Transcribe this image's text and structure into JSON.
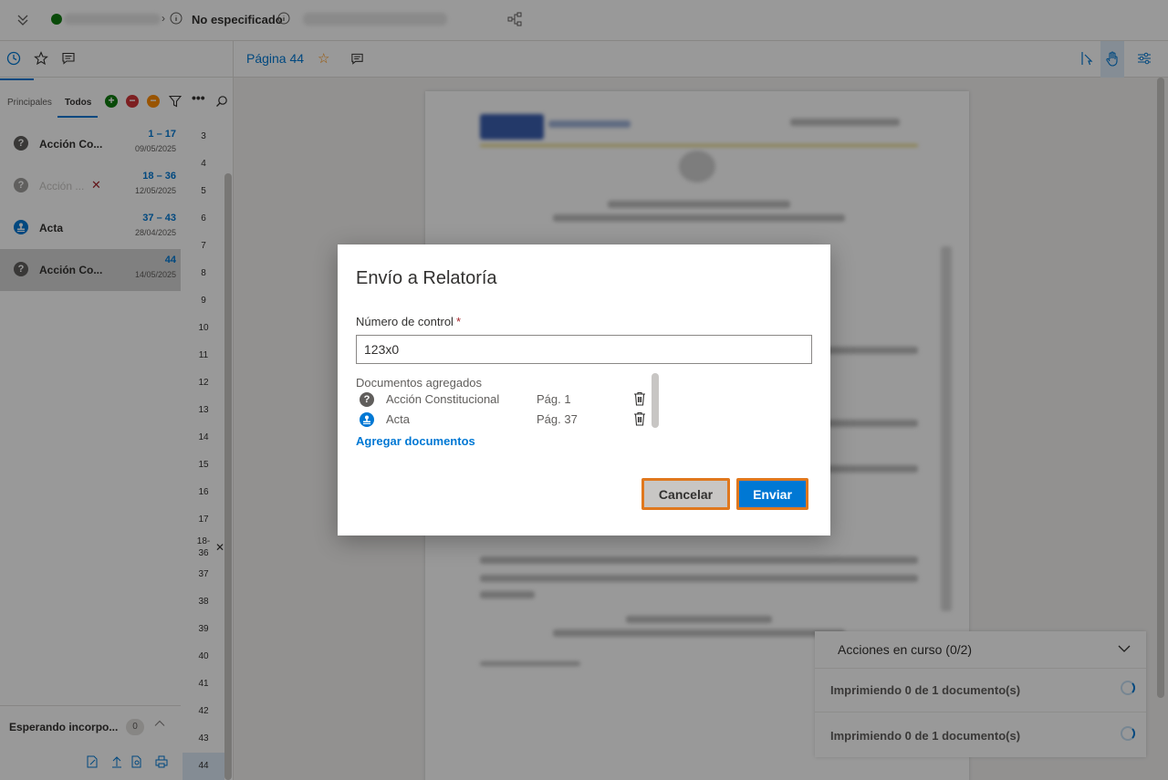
{
  "topbar": {
    "status_text": "No especificado"
  },
  "left_tabs": [
    "history-tab",
    "favorites-tab",
    "comments-tab"
  ],
  "filters": {
    "tabs": [
      "Principales",
      "Todos"
    ],
    "active": "Todos"
  },
  "documents": [
    {
      "name": "Acción Co...",
      "range": "1 – 17",
      "date": "09/05/2025",
      "icon": "question-icon",
      "color": "#605e5c",
      "muted": false,
      "removed": false,
      "selected": false
    },
    {
      "name": "Acción ...",
      "range": "18 – 36",
      "date": "12/05/2025",
      "icon": "question-icon",
      "color": "#a19f9d",
      "muted": true,
      "removed": true,
      "selected": false
    },
    {
      "name": "Acta",
      "range": "37 – 43",
      "date": "28/04/2025",
      "icon": "stamp-icon",
      "color": "#0078d4",
      "muted": false,
      "removed": false,
      "selected": false
    },
    {
      "name": "Acción Co...",
      "range": "44",
      "date": "14/05/2025",
      "icon": "question-icon",
      "color": "#605e5c",
      "muted": false,
      "removed": false,
      "selected": true
    }
  ],
  "page_numbers": [
    "3",
    "4",
    "5",
    "6",
    "7",
    "8",
    "9",
    "10",
    "11",
    "12",
    "13",
    "14",
    "15",
    "16",
    "17",
    "18-\n36",
    "37",
    "38",
    "39",
    "40",
    "41",
    "42",
    "43",
    "44"
  ],
  "waiting": {
    "label": "Esperando incorpo...",
    "count": "0"
  },
  "main": {
    "page_title": "Página 44"
  },
  "actions": {
    "title": "Acciones en curso (0/2)",
    "items": [
      "Imprimiendo 0 de 1 documento(s)",
      "Imprimiendo 0 de 1 documento(s)"
    ]
  },
  "dialog": {
    "title": "Envío a Relatoría",
    "field_label": "Número de control",
    "required_mark": "*",
    "field_value": "123x0",
    "docs_label": "Documentos agregados",
    "docs": [
      {
        "name": "Acción Constitucional",
        "page": "Pág. 1",
        "icon": "question-icon",
        "color": "#605e5c"
      },
      {
        "name": "Acta",
        "page": "Pág. 37",
        "icon": "stamp-icon",
        "color": "#0078d4"
      }
    ],
    "add_link": "Agregar documentos",
    "cancel_label": "Cancelar",
    "send_label": "Enviar"
  },
  "colors": {
    "accent": "#0078d4",
    "highlight_border": "#e0781e"
  }
}
